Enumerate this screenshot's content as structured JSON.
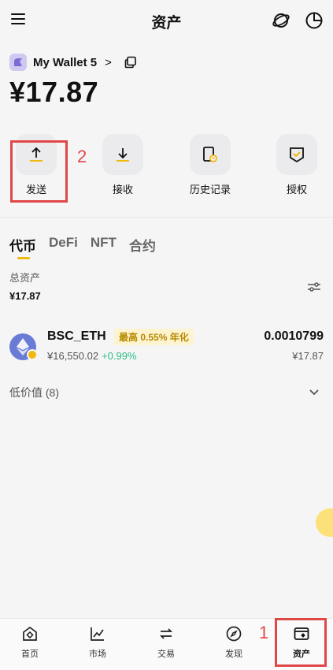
{
  "header": {
    "title": "资产",
    "menu_icon": "menu-icon",
    "globe_icon": "globe-icon",
    "pie_icon": "pie-chart-icon"
  },
  "wallet": {
    "name": "My Wallet 5",
    "chevron": ">",
    "balance": "¥17.87"
  },
  "actions": [
    {
      "label": "发送",
      "icon": "upload-arrow-icon"
    },
    {
      "label": "接收",
      "icon": "download-arrow-icon"
    },
    {
      "label": "历史记录",
      "icon": "history-doc-icon"
    },
    {
      "label": "授权",
      "icon": "shield-check-icon"
    }
  ],
  "annotations": {
    "step1": "1",
    "step2": "2",
    "highlight_color": "#e04848"
  },
  "tabs": [
    "代币",
    "DeFi",
    "NFT",
    "合约"
  ],
  "summary": {
    "label": "总资产",
    "value": "¥17.87"
  },
  "asset": {
    "name": "BSC_ETH",
    "apy": "最高 0.55% 年化",
    "price": "¥16,550.02",
    "change": "+0.99%",
    "amount": "0.0010799",
    "fiat": "¥17.87"
  },
  "low_value": {
    "label": "低价值 (8)"
  },
  "nav": [
    {
      "label": "首页",
      "icon": "home-icon"
    },
    {
      "label": "市场",
      "icon": "market-chart-icon"
    },
    {
      "label": "交易",
      "icon": "trade-swap-icon"
    },
    {
      "label": "发现",
      "icon": "discover-compass-icon"
    },
    {
      "label": "资产",
      "icon": "wallet-icon"
    }
  ],
  "colors": {
    "accent": "#f0b90b",
    "positive": "#2ebd85",
    "coin": "#6a7bd6"
  }
}
